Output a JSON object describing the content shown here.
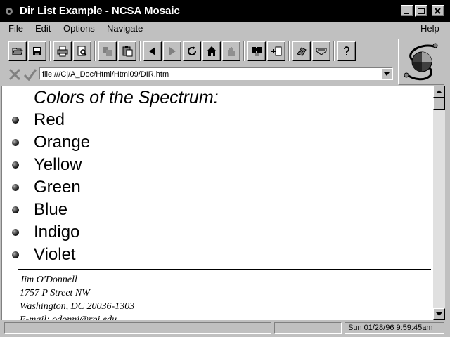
{
  "window": {
    "title": "Dir List Example - NCSA Mosaic"
  },
  "menu": [
    {
      "label": "File"
    },
    {
      "label": "Edit"
    },
    {
      "label": "Options"
    },
    {
      "label": "Navigate"
    },
    {
      "label": "Help"
    }
  ],
  "toolbar": {
    "icons": [
      "open-icon",
      "save-icon",
      "print-icon",
      "print-preview-icon",
      "copy-icon",
      "paste-icon",
      "back-icon",
      "forward-icon",
      "reload-icon",
      "home-icon",
      "stop-icon",
      "find-icon",
      "add-hotlist-icon",
      "hotlist-icon",
      "news-icon",
      "help-icon"
    ]
  },
  "address": {
    "url": "file:///C|/A_Doc/Html/Html09/DIR.htm"
  },
  "page": {
    "heading": "Colors of the Spectrum:",
    "colors": [
      "Red",
      "Orange",
      "Yellow",
      "Green",
      "Blue",
      "Indigo",
      "Violet"
    ],
    "address_lines": [
      "Jim O'Donnell",
      "1757 P Street NW",
      "Washington, DC 20036-1303",
      "E-mail: odonnj@rpi.edu"
    ]
  },
  "status": {
    "datetime": "Sun 01/28/96 9:59:45am"
  }
}
